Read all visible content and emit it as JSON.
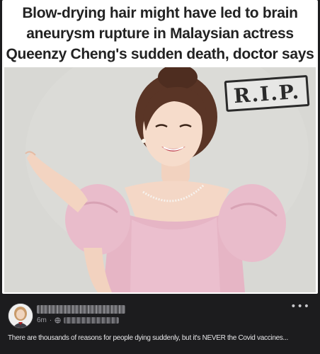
{
  "meme": {
    "headline_lines": [
      "Blow-drying hair might have led to brain",
      "aneurysm rupture in Malaysian actress",
      "Queenzy Cheng's sudden death, doctor says"
    ],
    "stamp_text": "R.I.P."
  },
  "post": {
    "timestamp": "6m",
    "separator": "·",
    "caption": "There are thousands of reasons for people dying suddenly, but it's NEVER the Covid vaccines...",
    "more_icon": "more-horizontal-icon",
    "privacy_icon": "globe-icon"
  },
  "colors": {
    "page_bg": "#1c1c1e",
    "dress": "#e8b8c8",
    "headline": "#222222"
  }
}
